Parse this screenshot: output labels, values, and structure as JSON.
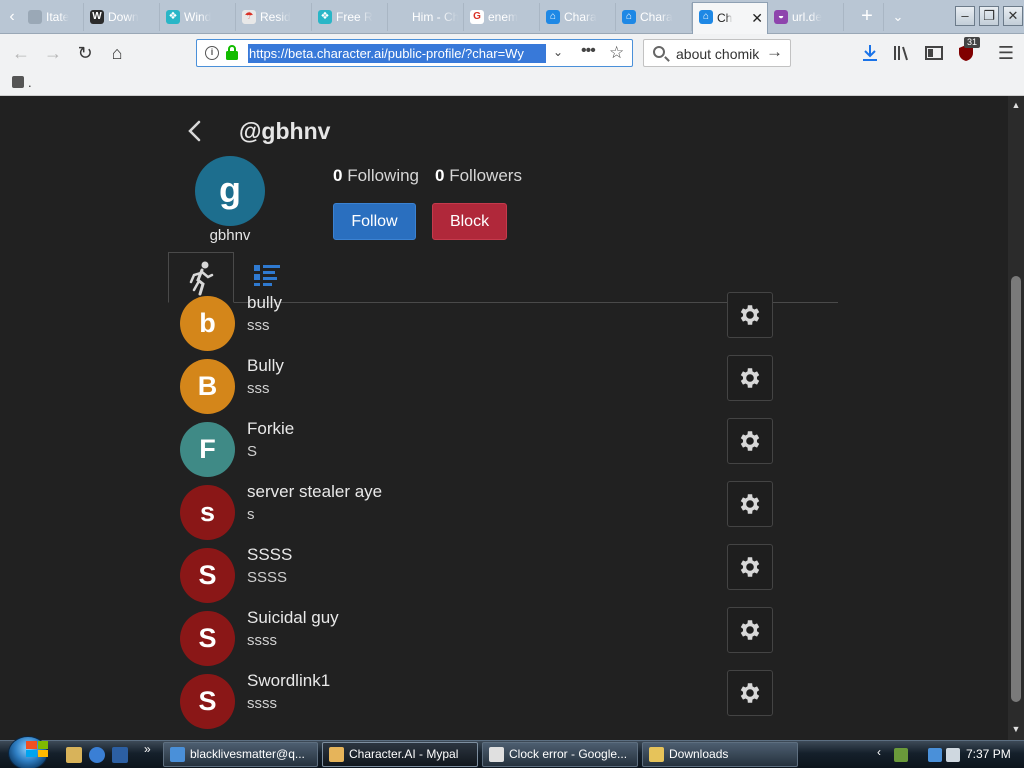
{
  "browser": {
    "tabs": [
      {
        "label": "Itate",
        "fav_color": "#9aa8b6",
        "fav_glyph": ""
      },
      {
        "label": "Down",
        "fav_color": "#2b2b2b",
        "fav_glyph": "W"
      },
      {
        "label": "Wind",
        "fav_color": "#29b6c7",
        "fav_glyph": "❖"
      },
      {
        "label": "Resid",
        "fav_color": "#e8e8e8",
        "fav_glyph": "☂"
      },
      {
        "label": "Free R",
        "fav_color": "#29b6c7",
        "fav_glyph": "❖"
      },
      {
        "label": "Him - Ch",
        "fav_color": "",
        "fav_glyph": ""
      },
      {
        "label": "enem",
        "fav_color": "#ffffff",
        "fav_glyph": "G"
      },
      {
        "label": "Chara",
        "fav_color": "#1e88e5",
        "fav_glyph": "⌂"
      },
      {
        "label": "Chara",
        "fav_color": "#1e88e5",
        "fav_glyph": "⌂"
      },
      {
        "label": "Ch",
        "fav_color": "#1e88e5",
        "fav_glyph": "⌂",
        "active": true
      },
      {
        "label": "url.de",
        "fav_color": "#8e44ad",
        "fav_glyph": "◒"
      },
      {
        "label": "",
        "fav_color": "",
        "fav_glyph": ""
      }
    ],
    "url": "https://beta.character.ai/public-profile/?char=Wy",
    "search_text": "about chomik",
    "extension_badge": "31",
    "bookmark_label": "."
  },
  "profile": {
    "handle": "@gbhnv",
    "avatar_letter": "g",
    "avatar_color": "#1d6e8e",
    "username": "gbhnv",
    "following_count": "0",
    "following_label": "Following",
    "followers_count": "0",
    "followers_label": "Followers",
    "follow_label": "Follow",
    "block_label": "Block"
  },
  "characters": [
    {
      "letter": "b",
      "name": "bully",
      "desc": "sss",
      "color": "#d4861a"
    },
    {
      "letter": "B",
      "name": "Bully",
      "desc": "sss",
      "color": "#d4861a"
    },
    {
      "letter": "F",
      "name": "Forkie",
      "desc": "S",
      "color": "#3f8a86"
    },
    {
      "letter": "s",
      "name": "server stealer aye",
      "desc": "s",
      "color": "#8a1717"
    },
    {
      "letter": "S",
      "name": "SSSS",
      "desc": "SSSS",
      "color": "#8a1717"
    },
    {
      "letter": "S",
      "name": "Suicidal guy",
      "desc": "ssss",
      "color": "#8a1717"
    },
    {
      "letter": "S",
      "name": "Swordlink1",
      "desc": "ssss",
      "color": "#8a1717"
    }
  ],
  "taskbar": {
    "tasks": [
      {
        "label": "blacklivesmatter@q...",
        "icon_color": "#4a90d9"
      },
      {
        "label": "Character.AI - Mypal",
        "icon_color": "#e6b45a"
      },
      {
        "label": "Clock error - Google...",
        "icon_color": "#e0e0e0"
      },
      {
        "label": "Downloads",
        "icon_color": "#e6c35a"
      }
    ],
    "clock": "7:37 PM"
  }
}
